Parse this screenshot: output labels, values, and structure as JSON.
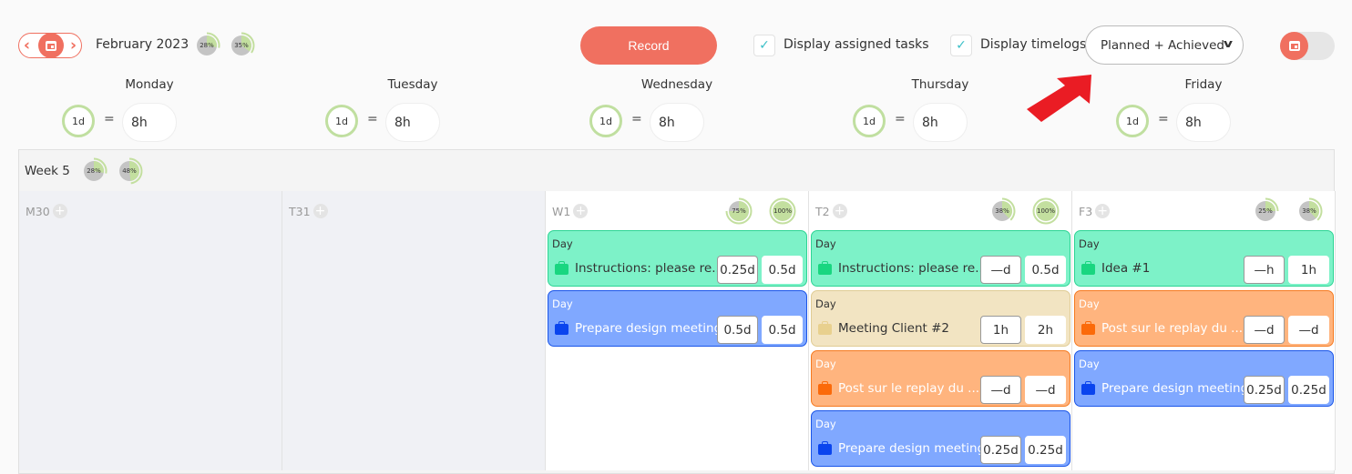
{
  "header": {
    "month": "February 2023",
    "month_stats": [
      {
        "label": "28%",
        "value": 0.28
      },
      {
        "label": "35%",
        "value": 0.35
      }
    ],
    "record_label": "Record",
    "display_assigned_tasks": {
      "label": "Display assigned tasks",
      "checked": true
    },
    "display_timelogs": {
      "label": "Display timelogs",
      "checked": true
    },
    "view_select": {
      "value": "Planned + Achieved"
    },
    "calendar_toggle": {
      "on": false
    }
  },
  "days": [
    {
      "name": "Monday",
      "capacity": "1d",
      "eq": "=",
      "hours": "8h"
    },
    {
      "name": "Tuesday",
      "capacity": "1d",
      "eq": "=",
      "hours": "8h"
    },
    {
      "name": "Wednesday",
      "capacity": "1d",
      "eq": "=",
      "hours": "8h"
    },
    {
      "name": "Thursday",
      "capacity": "1d",
      "eq": "=",
      "hours": "8h"
    },
    {
      "name": "Friday",
      "capacity": "1d",
      "eq": "=",
      "hours": "8h"
    }
  ],
  "week": {
    "label": "Week 5",
    "stats": [
      {
        "label": "28%",
        "value": 0.28
      },
      {
        "label": "48%",
        "value": 0.48
      }
    ],
    "columns": [
      {
        "label": "M30",
        "stats": [],
        "tasks": []
      },
      {
        "label": "T31",
        "stats": [],
        "tasks": []
      },
      {
        "label": "W1",
        "stats": [
          {
            "label": "75%",
            "value": 0.75
          },
          {
            "label": "100%",
            "value": 1.0
          }
        ],
        "tasks": [
          {
            "kind": "Day",
            "name": "Instructions: please re...",
            "planned": "0.25d",
            "achieved": "0.5d",
            "color": "green"
          },
          {
            "kind": "Day",
            "name": "Prepare design meeting",
            "planned": "0.5d",
            "achieved": "0.5d",
            "color": "blue"
          }
        ]
      },
      {
        "label": "T2",
        "stats": [
          {
            "label": "38%",
            "value": 0.38
          },
          {
            "label": "100%",
            "value": 1.0
          }
        ],
        "tasks": [
          {
            "kind": "Day",
            "name": "Instructions: please re...",
            "planned": "—d",
            "achieved": "0.5d",
            "color": "green"
          },
          {
            "kind": "Day",
            "name": "Meeting Client #2",
            "planned": "1h",
            "achieved": "2h",
            "color": "beige"
          },
          {
            "kind": "Day",
            "name": "Post sur le replay du ...",
            "planned": "—d",
            "achieved": "—d",
            "color": "orange"
          },
          {
            "kind": "Day",
            "name": "Prepare design meeting",
            "planned": "0.25d",
            "achieved": "0.25d",
            "color": "blue"
          }
        ]
      },
      {
        "label": "F3",
        "stats": [
          {
            "label": "25%",
            "value": 0.25
          },
          {
            "label": "38%",
            "value": 0.38
          }
        ],
        "tasks": [
          {
            "kind": "Day",
            "name": "Idea #1",
            "planned": "—h",
            "achieved": "1h",
            "color": "green"
          },
          {
            "kind": "Day",
            "name": "Post sur le replay du ...",
            "planned": "—d",
            "achieved": "—d",
            "color": "orange"
          },
          {
            "kind": "Day",
            "name": "Prepare design meeting",
            "planned": "0.25d",
            "achieved": "0.25d",
            "color": "blue"
          }
        ]
      }
    ]
  }
}
